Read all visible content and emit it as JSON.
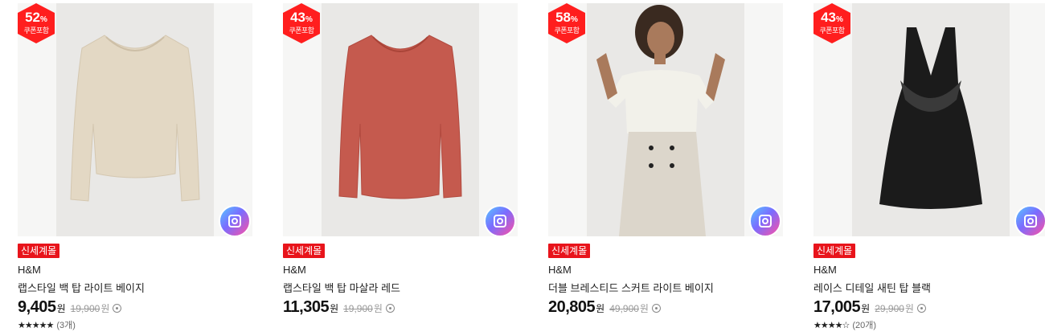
{
  "products": [
    {
      "discount_pct": "52",
      "pct_sign": "%",
      "coupon": "쿠폰포함",
      "tag": "신세계몰",
      "brand": "H&M",
      "title": "랩스타일 백 탑 라이트 베이지",
      "price": "9,405",
      "currency": "원",
      "original_price": "19,900",
      "stars": "★★★★★",
      "reviews": "(3개)",
      "garment_color": "#e3d8c4",
      "image": "beige long-sleeve top"
    },
    {
      "discount_pct": "43",
      "pct_sign": "%",
      "coupon": "쿠폰포함",
      "tag": "신세계몰",
      "brand": "H&M",
      "title": "랩스타일 백 탑 마살라 레드",
      "price": "11,305",
      "currency": "원",
      "original_price": "19,900",
      "stars": "",
      "reviews": "",
      "garment_color": "#c55a4e",
      "image": "red long-sleeve top"
    },
    {
      "discount_pct": "58",
      "pct_sign": "%",
      "coupon": "쿠폰포함",
      "tag": "신세계몰",
      "brand": "H&M",
      "title": "더블 브레스티드 스커트 라이트 베이지",
      "price": "20,805",
      "currency": "원",
      "original_price": "49,900",
      "stars": "",
      "reviews": "",
      "garment_color": "#dcd6cb",
      "image": "model in beige skirt"
    },
    {
      "discount_pct": "43",
      "pct_sign": "%",
      "coupon": "쿠폰포함",
      "tag": "신세계몰",
      "brand": "H&M",
      "title": "레이스 디테일 새틴 탑 블랙",
      "price": "17,005",
      "currency": "원",
      "original_price": "29,900",
      "stars": "★★★★☆",
      "reviews": "(20개)",
      "garment_color": "#1b1b1b",
      "image": "black lace satin top"
    }
  ],
  "colors": {
    "badge_red": "#ff1e1e",
    "tag_red": "#e8141b"
  }
}
